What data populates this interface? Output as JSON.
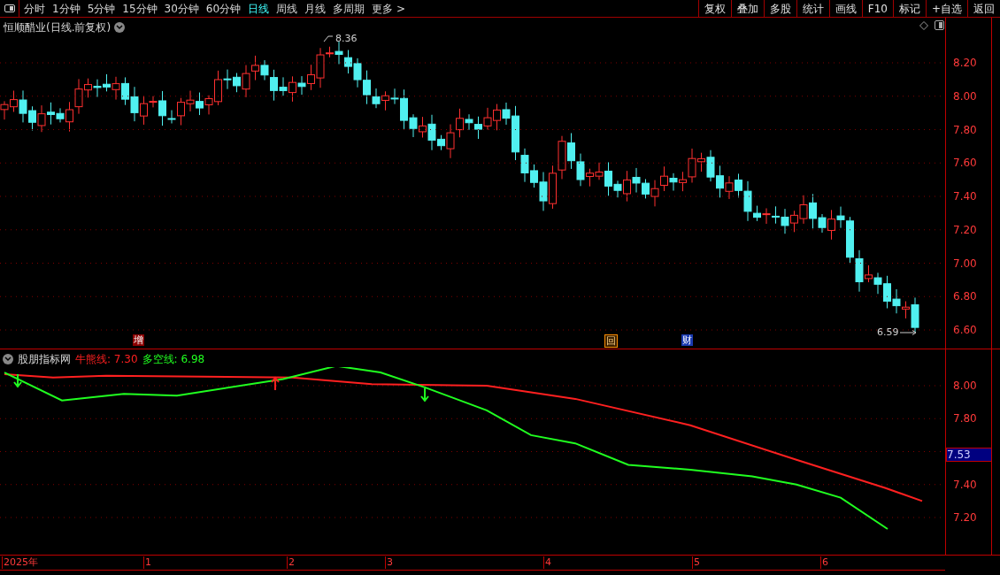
{
  "toolbar": {
    "periods": [
      {
        "label": "分时",
        "selected": false
      },
      {
        "label": "1分钟",
        "selected": false
      },
      {
        "label": "5分钟",
        "selected": false
      },
      {
        "label": "15分钟",
        "selected": false
      },
      {
        "label": "30分钟",
        "selected": false
      },
      {
        "label": "60分钟",
        "selected": false
      },
      {
        "label": "日线",
        "selected": true
      },
      {
        "label": "周线",
        "selected": false
      },
      {
        "label": "月线",
        "selected": false
      },
      {
        "label": "多周期",
        "selected": false
      },
      {
        "label": "更多 >",
        "selected": false
      }
    ],
    "buttons": [
      "复权",
      "叠加",
      "多股",
      "统计",
      "画线",
      "F10",
      "标记",
      "+自选",
      "返回"
    ]
  },
  "price_panel": {
    "title": "恒顺醋业(日线.前复权)",
    "high_label": "8.36",
    "low_label": "6.59",
    "y_labels": [
      "8.20",
      "8.00",
      "7.80",
      "7.60",
      "7.40",
      "7.20",
      "7.00",
      "6.80",
      "6.60"
    ],
    "markers": [
      {
        "text": "增",
        "kind": "filled"
      },
      {
        "text": "回",
        "kind": "boxed"
      },
      {
        "text": "财",
        "kind": "blue"
      }
    ]
  },
  "indicator_panel": {
    "name": "股朋指标网",
    "legend": [
      {
        "label": "牛熊线: 7.30",
        "color": "#ff2020"
      },
      {
        "label": "多空线: 6.98",
        "color": "#20ff20"
      }
    ],
    "y_labels": [
      "8.00",
      "7.80",
      "7.40",
      "7.20"
    ],
    "highlight": "7.53"
  },
  "date_axis": [
    "2025年",
    "1",
    "2",
    "3",
    "4",
    "5",
    "6"
  ]
}
